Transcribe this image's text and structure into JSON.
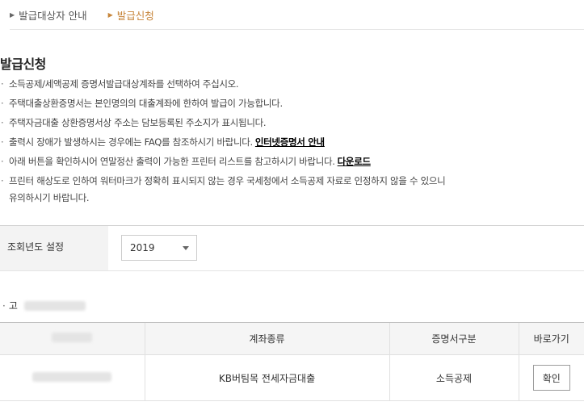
{
  "tabs": [
    {
      "label": "발급대상자 안내",
      "active": false
    },
    {
      "label": "발급신청",
      "active": true
    }
  ],
  "section_title": "발급신청",
  "notes": [
    "소득공제/세액공제 증명서발급대상계좌를 선택하여 주십시오.",
    "주택대출상환증명서는 본인명의의 대출계좌에 한하여 발급이 가능합니다.",
    "주택자금대출 상환증명서상 주소는 담보등록된 주소지가 표시됩니다.",
    "출력시 장애가 발생하시는 경우에는 FAQ를 참조하시기 바랍니다.",
    "아래 버튼을 확인하시어 연말정산 출력이 가능한 프린터 리스트를 참고하시기 바랍니다.",
    "프린터 해상도로 인하여 워터마크가 정확히 표시되지 않는 경우 국세청에서 소득공제 자료로 인정하지 않을 수 있으니",
    "유의하시기 바랍니다."
  ],
  "links": {
    "internet_cert_guide": "인터넷증명서 안내",
    "download": "다운로드"
  },
  "year_setting": {
    "label": "조회년도 설정",
    "selected": "2019"
  },
  "owner_prefix": "고",
  "table": {
    "headers": [
      "계좌종류",
      "증명서구분",
      "바로가기"
    ],
    "rows": [
      {
        "account_type": "KB버팀목 전세자금대출",
        "cert_type": "소득공제",
        "action_label": "확인"
      }
    ]
  },
  "colors": {
    "active_tab": "#c7853a",
    "label_bg": "#f3f3f3",
    "header_bg": "#f5f5f5"
  }
}
